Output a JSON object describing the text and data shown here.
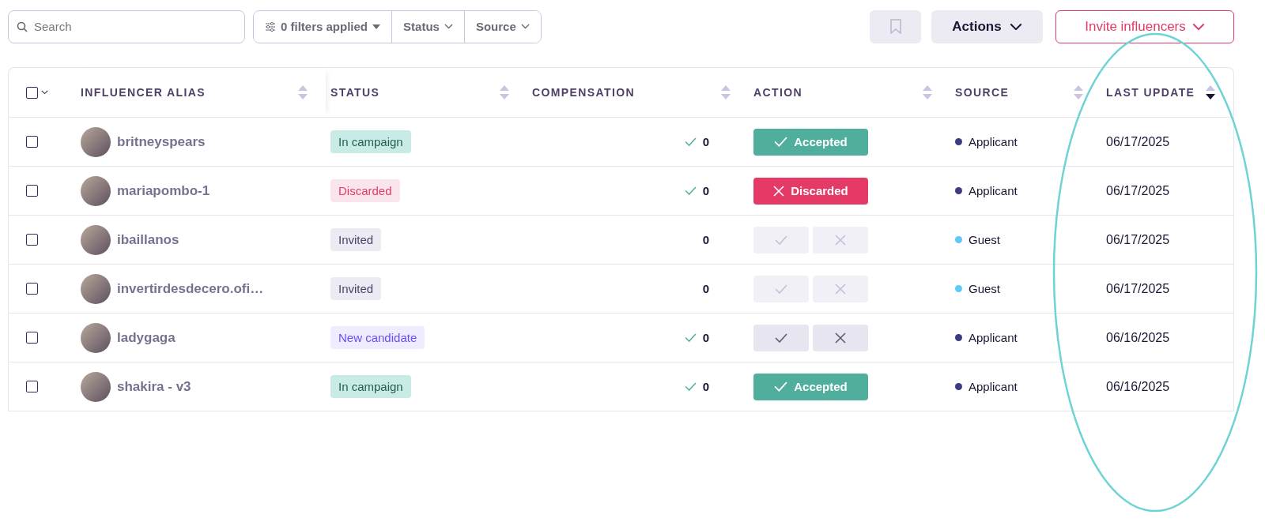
{
  "toolbar": {
    "search": {
      "placeholder": "Search"
    },
    "filters": {
      "label": "0 filters applied"
    },
    "dropdowns": [
      "Status",
      "Source"
    ],
    "actions": {
      "label": "Actions"
    },
    "invite": {
      "label": "Invite influencers"
    }
  },
  "table": {
    "select_all": {
      "checked": false
    },
    "columns": [
      {
        "label": "INFLUENCER ALIAS",
        "sorted": false
      },
      {
        "label": "STATUS",
        "sorted": false
      },
      {
        "label": "COMPENSATION",
        "sorted": false
      },
      {
        "label": "ACTION",
        "sorted": false
      },
      {
        "label": "SOURCE",
        "sorted": false
      },
      {
        "label": "LAST UPDATE",
        "sorted": true
      }
    ],
    "rows": [
      {
        "checked": false,
        "alias": "britneyspears",
        "status": {
          "label": "In campaign",
          "kind": "campaign"
        },
        "compensation": {
          "value": "0",
          "confirmed": true
        },
        "action": {
          "kind": "accepted",
          "label": "Accepted"
        },
        "source": {
          "label": "Applicant",
          "color": "#3d3a80"
        },
        "last_update": "06/17/2025"
      },
      {
        "checked": false,
        "alias": "mariapombo-1",
        "status": {
          "label": "Discarded",
          "kind": "discarded"
        },
        "compensation": {
          "value": "0",
          "confirmed": true
        },
        "action": {
          "kind": "discarded",
          "label": "Discarded"
        },
        "source": {
          "label": "Applicant",
          "color": "#3d3a80"
        },
        "last_update": "06/17/2025"
      },
      {
        "checked": false,
        "alias": "ibaillanos",
        "status": {
          "label": "Invited",
          "kind": "invited"
        },
        "compensation": {
          "value": "0",
          "confirmed": false
        },
        "action": {
          "kind": "pending",
          "disabled": true
        },
        "source": {
          "label": "Guest",
          "color": "#5ec8f8"
        },
        "last_update": "06/17/2025"
      },
      {
        "checked": false,
        "alias": "invertirdesdecero.ofi…",
        "status": {
          "label": "Invited",
          "kind": "invited"
        },
        "compensation": {
          "value": "0",
          "confirmed": false
        },
        "action": {
          "kind": "pending",
          "disabled": true
        },
        "source": {
          "label": "Guest",
          "color": "#5ec8f8"
        },
        "last_update": "06/17/2025"
      },
      {
        "checked": false,
        "alias": "ladygaga",
        "status": {
          "label": "New candidate",
          "kind": "candidate"
        },
        "compensation": {
          "value": "0",
          "confirmed": true
        },
        "action": {
          "kind": "pending",
          "disabled": false
        },
        "source": {
          "label": "Applicant",
          "color": "#3d3a80"
        },
        "last_update": "06/16/2025"
      },
      {
        "checked": false,
        "alias": "shakira - v3",
        "status": {
          "label": "In campaign",
          "kind": "campaign"
        },
        "compensation": {
          "value": "0",
          "confirmed": true
        },
        "action": {
          "kind": "accepted",
          "label": "Accepted"
        },
        "source": {
          "label": "Applicant",
          "color": "#3d3a80"
        },
        "last_update": "06/16/2025"
      }
    ]
  }
}
